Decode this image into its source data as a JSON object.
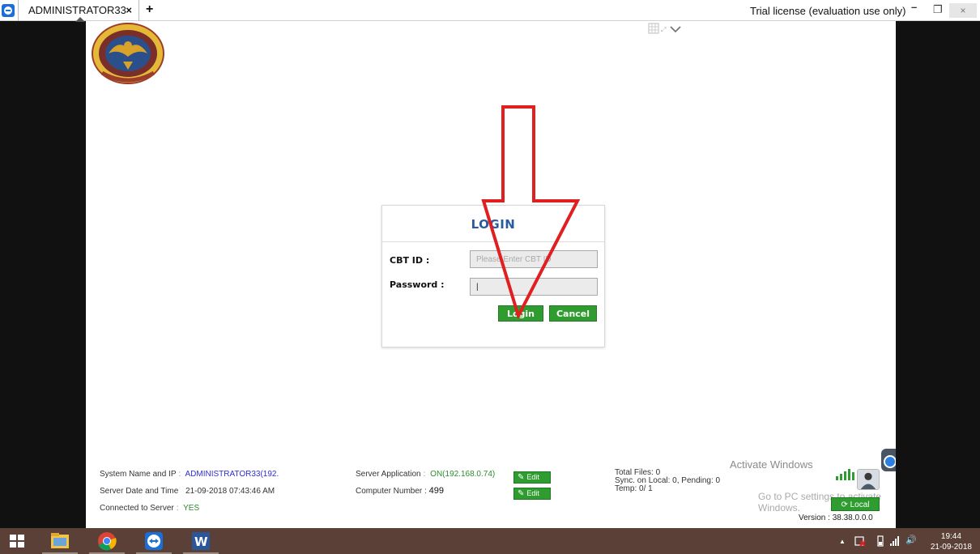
{
  "window": {
    "tab_title": "ADMINISTRATOR33",
    "tab_close": "×",
    "tab_add": "+",
    "license_notice": "Trial license (evaluation use only)",
    "minimize": "–",
    "restore": "❐",
    "close": "×"
  },
  "login": {
    "title": "LOGIN",
    "cbt_label": "CBT ID :",
    "cbt_placeholder": "Please Enter CBT ID",
    "password_label": "Password :",
    "password_value": "|",
    "login_button": "Login",
    "cancel_button": "Cancel"
  },
  "status": {
    "system_name_label": "System Name and IP",
    "system_name_value": "ADMINISTRATOR33(192.",
    "server_date_label": "Server Date and Time",
    "server_date_value": "21-09-2018 07:43:46 AM",
    "connected_label": "Connected to Server",
    "connected_value": "YES",
    "server_app_label": "Server Application",
    "server_app_value": "ON(192.168.0.74)",
    "computer_number_label": "Computer Number :",
    "computer_number_value": "499",
    "edit_label": "Edit",
    "total_files": "Total Files: 0",
    "sync_status": "Sync. on Local: 0, Pending: 0",
    "temp": "Temp: 0/ 1",
    "local_button": "Local",
    "version": "Version : 38.38.0.0.0"
  },
  "watermark": {
    "line1": "Activate Windows",
    "line2": "Go to PC settings to activate Windows."
  },
  "taskbar": {
    "time": "19:44",
    "date": "21-09-2018",
    "up_arrow": "▲",
    "volume": "🔊"
  },
  "colors": {
    "accent_green": "#2e9c2e",
    "login_title_blue": "#2a5b9e",
    "arrow_red": "#e02020",
    "taskbar_brown": "#5a4037"
  }
}
